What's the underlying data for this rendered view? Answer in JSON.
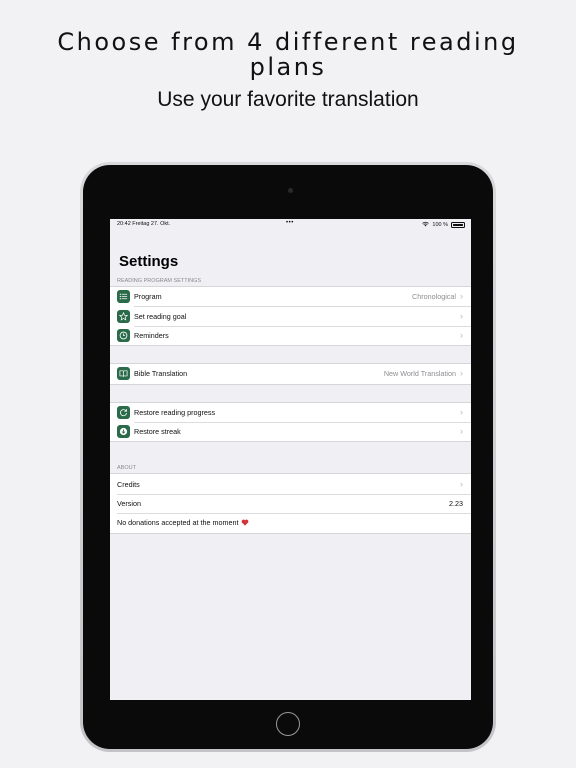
{
  "promo": {
    "headline_line1": "Choose from 4 different reading",
    "headline_line2": "plans",
    "subheadline": "Use your favorite translation"
  },
  "statusbar": {
    "time_date": "20:42  Freitag 27. Okt.",
    "dots": "•••",
    "battery": "100 %"
  },
  "settings": {
    "title": "Settings",
    "reading_section_header": "READING PROGRAM SETTINGS",
    "program": {
      "label": "Program",
      "value": "Chronological",
      "icon": "list-icon"
    },
    "reading_goal": {
      "label": "Set reading goal",
      "icon": "star-icon"
    },
    "reminders": {
      "label": "Reminders",
      "icon": "clock-icon"
    },
    "translation": {
      "label": "Bible Translation",
      "value": "New World Translation",
      "icon": "book-icon"
    },
    "restore_progress": {
      "label": "Restore reading progress",
      "icon": "restore-icon"
    },
    "restore_streak": {
      "label": "Restore streak",
      "icon": "download-icon"
    },
    "about_header": "ABOUT",
    "credits": {
      "label": "Credits"
    },
    "version": {
      "label": "Version",
      "value": "2.23"
    },
    "donations": {
      "label": "No donations accepted at the moment"
    }
  },
  "colors": {
    "icon_bg": "#2b6b4a",
    "background": "#efeff4",
    "heart": "#d0333a"
  }
}
